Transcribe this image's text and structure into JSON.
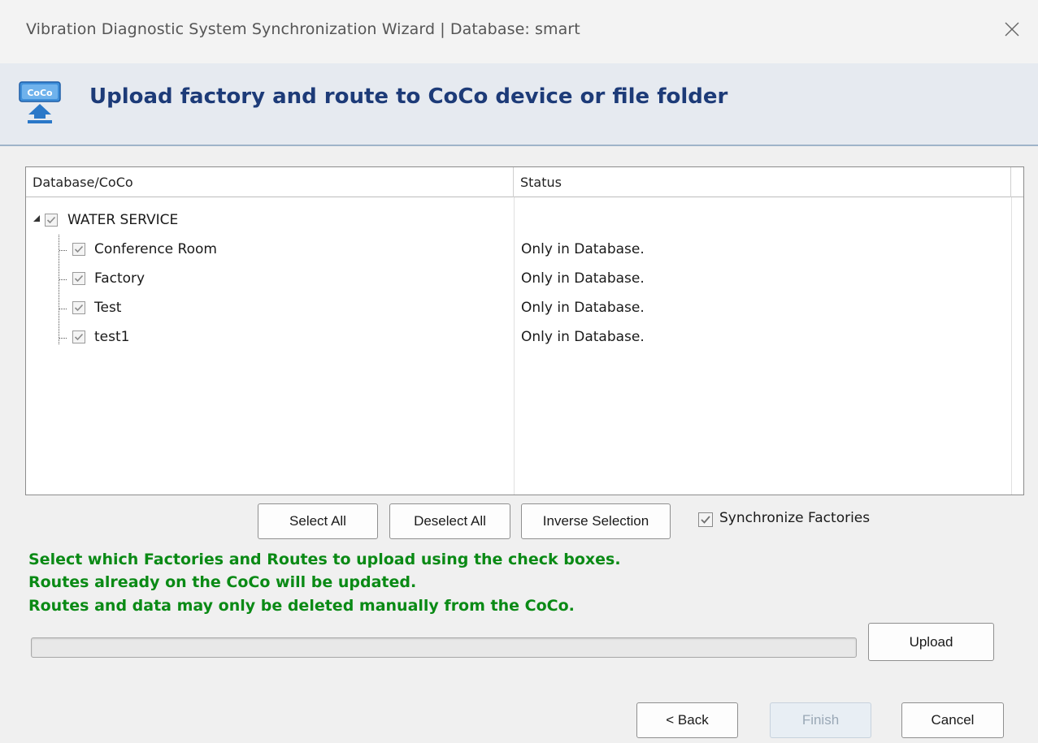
{
  "window": {
    "title": "Vibration Diagnostic System Synchronization Wizard | Database: smart",
    "close_icon": "close-icon"
  },
  "header": {
    "title": "Upload factory and route to CoCo device or file folder",
    "icon_text": "CoCo",
    "icon": "coco-upload-icon"
  },
  "tree": {
    "columns": [
      "Database/CoCo",
      "Status"
    ],
    "root": {
      "label": "WATER SERVICE",
      "checked": true,
      "expanded": true
    },
    "children": [
      {
        "label": "Conference Room",
        "status": "Only in Database.",
        "checked": true
      },
      {
        "label": "Factory",
        "status": "Only in Database.",
        "checked": true
      },
      {
        "label": "Test",
        "status": "Only in Database.",
        "checked": true
      },
      {
        "label": "test1",
        "status": "Only in Database.",
        "checked": true
      }
    ]
  },
  "selection_buttons": {
    "select_all": "Select All",
    "deselect_all": "Deselect All",
    "inverse_selection": "Inverse Selection"
  },
  "synchronize_factories": {
    "label": "Synchronize Factories",
    "checked": true
  },
  "instructions": [
    "Select which Factories and Routes to upload using the check boxes.",
    "Routes already on the CoCo will be updated.",
    "Routes and data may only be deleted manually from the CoCo."
  ],
  "progress": {
    "value": 0
  },
  "upload_button": "Upload",
  "footer": {
    "back": "< Back",
    "finish": "Finish",
    "cancel": "Cancel"
  },
  "colors": {
    "header_title": "#1d3b78",
    "instructions": "#0a8a15",
    "header_bg": "#e6eaf0"
  }
}
